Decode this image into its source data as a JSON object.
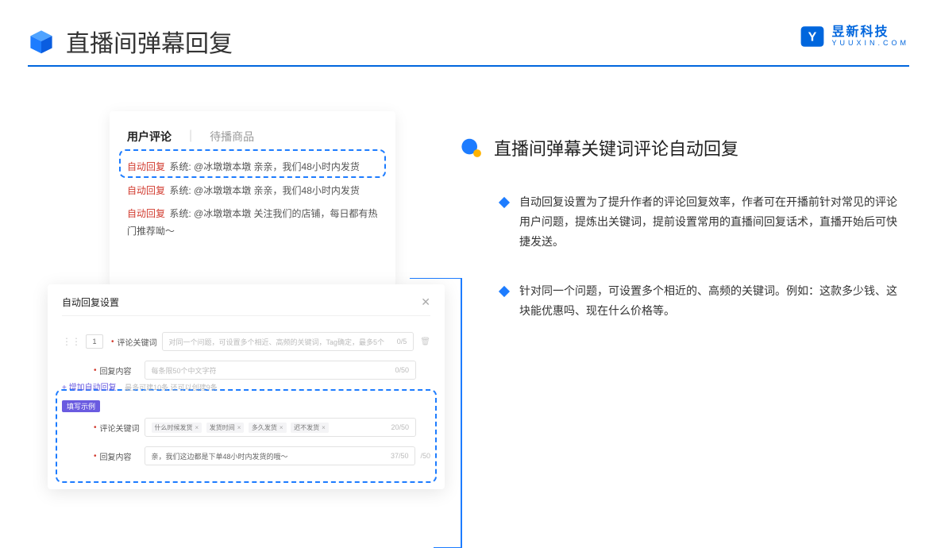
{
  "header": {
    "title": "直播间弹幕回复",
    "brand_name": "昱新科技",
    "brand_sub": "YUUXIN.COM"
  },
  "comment_card": {
    "tab_active": "用户评论",
    "tab_inactive": "待播商品",
    "rows": [
      {
        "tag": "自动回复",
        "text": "系统: @冰墩墩本墩 亲亲，我们48小时内发货"
      },
      {
        "tag": "自动回复",
        "text": "系统: @冰墩墩本墩 亲亲，我们48小时内发货"
      },
      {
        "tag": "自动回复",
        "text": "系统: @冰墩墩本墩 关注我们的店铺，每日都有热门推荐呦～"
      }
    ]
  },
  "settings_card": {
    "title": "自动回复设置",
    "index": "1",
    "keyword_label": "评论关键词",
    "keyword_placeholder": "对同一个问题，可设置多个相近、高频的关键词，Tag确定，最多5个",
    "keyword_counter": "0/5",
    "content_label": "回复内容",
    "content_placeholder": "每条限50个中文字符",
    "content_counter": "0/50",
    "add_link": "+ 增加自动回复",
    "add_hint": "最多可建10条 还可以创建9条",
    "example_badge": "填写示例",
    "ex_keyword_label": "评论关键词",
    "ex_tags": [
      "什么时候发货",
      "发货时间",
      "多久发货",
      "迟不发货"
    ],
    "ex_keyword_counter": "20/50",
    "ex_content_label": "回复内容",
    "ex_content_value": "亲，我们这边都是下单48小时内发货的哦～",
    "ex_content_counter": "37/50",
    "outer_counter": "/50"
  },
  "right": {
    "title": "直播间弹幕关键词评论自动回复",
    "bullets": [
      "自动回复设置为了提升作者的评论回复效率，作者可在开播前针对常见的评论用户问题，提炼出关键词，提前设置常用的直播间回复话术，直播开始后可快捷发送。",
      "针对同一个问题，可设置多个相近的、高频的关键词。例如：这款多少钱、这块能优惠吗、现在什么价格等。"
    ]
  }
}
